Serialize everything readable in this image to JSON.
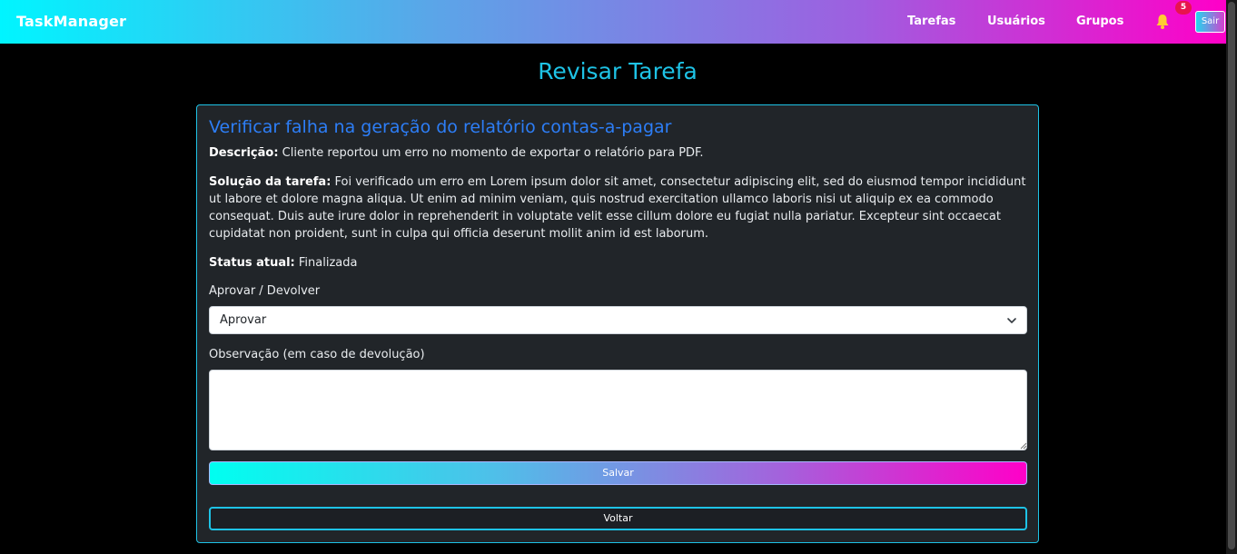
{
  "navbar": {
    "brand": "TaskManager",
    "links": {
      "tarefas": "Tarefas",
      "usuarios": "Usuários",
      "grupos": "Grupos"
    },
    "notifications_icon": "bell-icon",
    "notifications_count": "5",
    "logout_label": "Sair"
  },
  "page": {
    "title": "Revisar Tarefa"
  },
  "task": {
    "title": "Verificar falha na geração do relatório contas-a-pagar",
    "description_label": "Descrição:",
    "description": " Cliente reportou um erro no momento de exportar o relatório para PDF.",
    "solution_label": "Solução da tarefa:",
    "solution": " Foi verificado um erro em Lorem ipsum dolor sit amet, consectetur adipiscing elit, sed do eiusmod tempor incididunt ut labore et dolore magna aliqua. Ut enim ad minim veniam, quis nostrud exercitation ullamco laboris nisi ut aliquip ex ea commodo consequat. Duis aute irure dolor in reprehenderit in voluptate velit esse cillum dolore eu fugiat nulla pariatur. Excepteur sint occaecat cupidatat non proident, sunt in culpa qui officia deserunt mollit anim id est laborum.",
    "status_label": "Status atual:",
    "status": " Finalizada"
  },
  "form": {
    "decision_label": "Aprovar / Devolver",
    "decision_selected": "Aprovar",
    "decision_icon": "chevron-down-icon",
    "observation_label": "Observação (em caso de devolução)",
    "observation_value": "",
    "save_label": "Salvar",
    "back_label": "Voltar"
  },
  "colors": {
    "accent": "#1ec3e6",
    "title_blue": "#2d7ef7",
    "card_bg": "#212529",
    "badge": "#e8134e",
    "gradient_start": "#00f5ff",
    "gradient_end": "#ff00c8"
  }
}
